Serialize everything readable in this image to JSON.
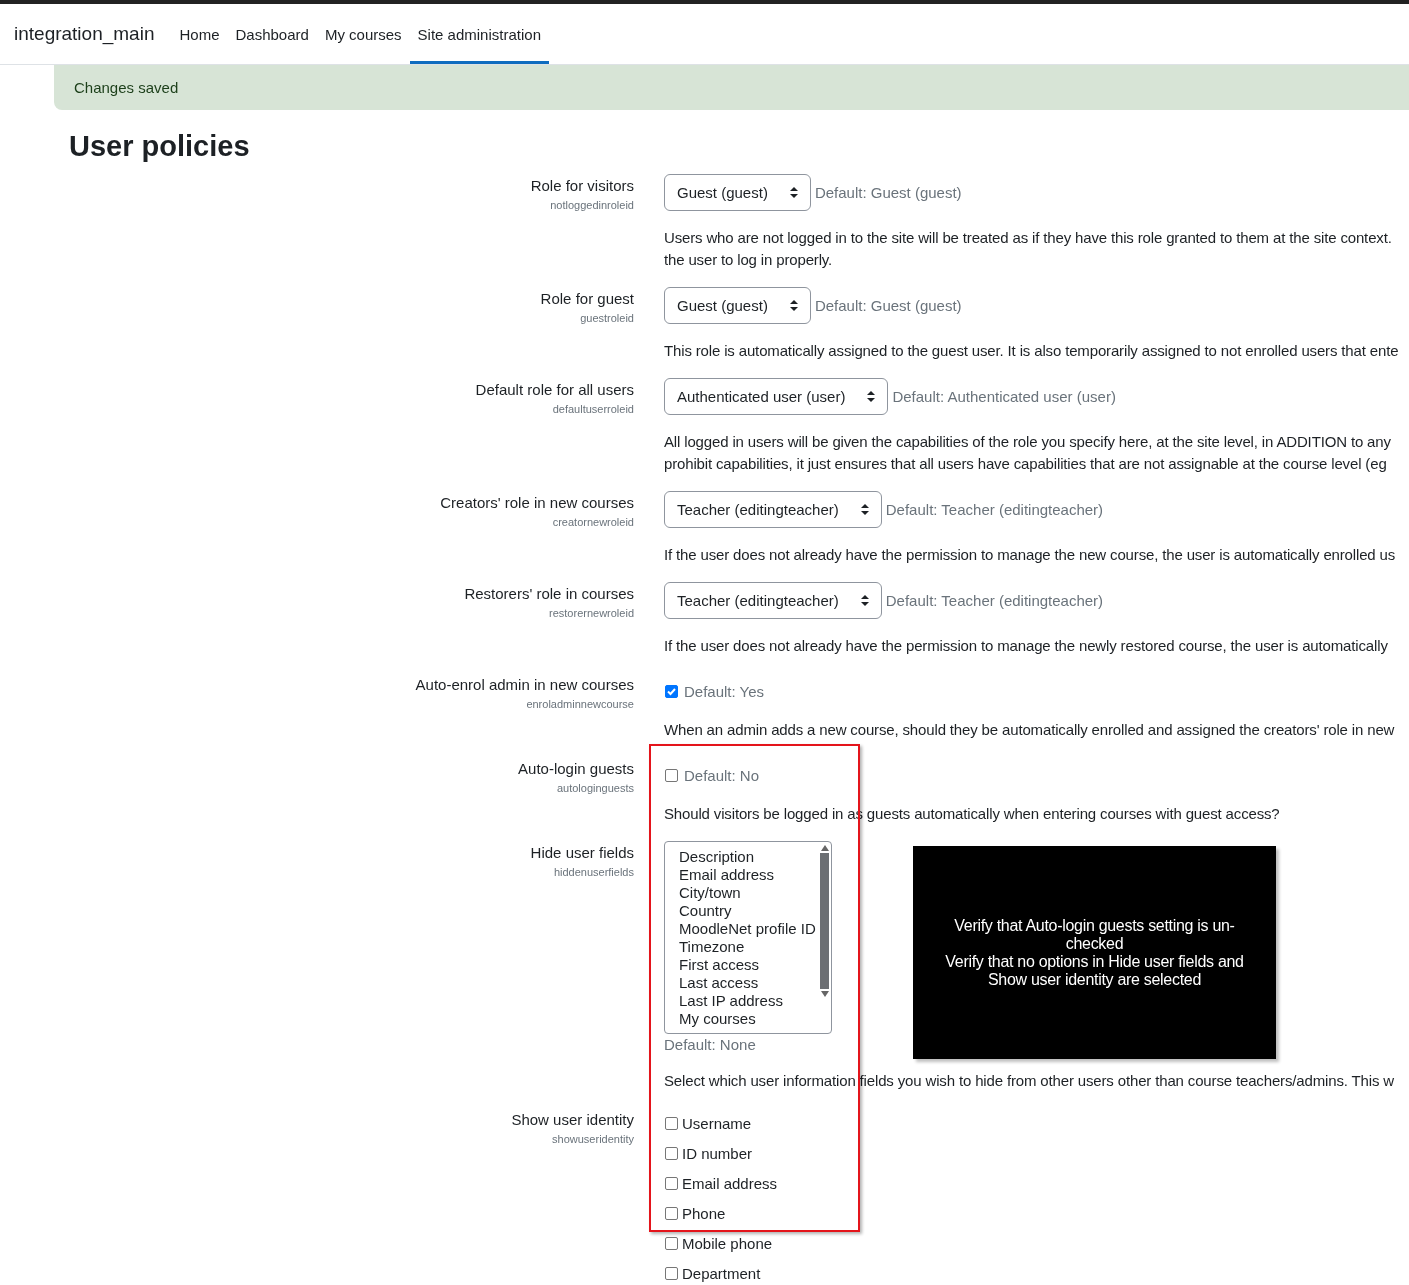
{
  "navbar": {
    "site_name": "integration_main",
    "items": [
      {
        "label": "Home",
        "selected": false
      },
      {
        "label": "Dashboard",
        "selected": false
      },
      {
        "label": "My courses",
        "selected": false
      },
      {
        "label": "Site administration",
        "selected": true
      }
    ]
  },
  "alert": {
    "text": "Changes saved"
  },
  "page_title": "User policies",
  "settings": [
    {
      "kind": "select",
      "label": "Role for visitors",
      "name": "notloggedinroleid",
      "value": "Guest (guest)",
      "default": "Default: Guest (guest)",
      "description": [
        "Users who are not logged in to the site will be treated as if they have this role granted to them at the site context.",
        "the user to log in properly."
      ]
    },
    {
      "kind": "select",
      "label": "Role for guest",
      "name": "guestroleid",
      "value": "Guest (guest)",
      "default": "Default: Guest (guest)",
      "description": [
        "This role is automatically assigned to the guest user. It is also temporarily assigned to not enrolled users that ente"
      ]
    },
    {
      "kind": "select",
      "label": "Default role for all users",
      "name": "defaultuserroleid",
      "value": "Authenticated user (user)",
      "default": "Default: Authenticated user (user)",
      "description": [
        "All logged in users will be given the capabilities of the role you specify here, at the site level, in ADDITION to any",
        "prohibit capabilities, it just ensures that all users have capabilities that are not assignable at the course level (eg"
      ]
    },
    {
      "kind": "select",
      "label": "Creators' role in new courses",
      "name": "creatornewroleid",
      "value": "Teacher (editingteacher)",
      "default": "Default: Teacher (editingteacher)",
      "description": [
        "If the user does not already have the permission to manage the new course, the user is automatically enrolled us"
      ]
    },
    {
      "kind": "select",
      "label": "Restorers' role in courses",
      "name": "restorernewroleid",
      "value": "Teacher (editingteacher)",
      "default": "Default: Teacher (editingteacher)",
      "description": [
        "If the user does not already have the permission to manage the newly restored course, the user is automatically"
      ]
    },
    {
      "kind": "checkbox",
      "label": "Auto-enrol admin in new courses",
      "name": "enroladminnewcourse",
      "checked": true,
      "default": "Default: Yes",
      "description": [
        "When an admin adds a new course, should they be automatically enrolled and assigned the creators' role in new"
      ]
    },
    {
      "kind": "checkbox",
      "label": "Auto-login guests",
      "name": "autologinguests",
      "checked": false,
      "default": "Default: No",
      "description": [
        "Should visitors be logged in as guests automatically when entering courses with guest access?"
      ]
    },
    {
      "kind": "multiselect",
      "label": "Hide user fields",
      "name": "hiddenuserfields",
      "options": [
        {
          "label": "Description",
          "selected": false
        },
        {
          "label": "Email address",
          "selected": false
        },
        {
          "label": "City/town",
          "selected": false
        },
        {
          "label": "Country",
          "selected": false
        },
        {
          "label": "MoodleNet profile ID",
          "selected": false
        },
        {
          "label": "Timezone",
          "selected": false
        },
        {
          "label": "First access",
          "selected": false
        },
        {
          "label": "Last access",
          "selected": false
        },
        {
          "label": "Last IP address",
          "selected": false
        },
        {
          "label": "My courses",
          "selected": false
        }
      ],
      "default": "Default: None",
      "description": [
        "Select which user information fields you wish to hide from other users other than course teachers/admins. This w"
      ]
    },
    {
      "kind": "checkboxes",
      "label": "Show user identity",
      "name": "showuseridentity",
      "options": [
        {
          "label": "Username",
          "checked": false
        },
        {
          "label": "ID number",
          "checked": false
        },
        {
          "label": "Email address",
          "checked": false
        },
        {
          "label": "Phone",
          "checked": false
        },
        {
          "label": "Mobile phone",
          "checked": false
        },
        {
          "label": "Department",
          "checked": false
        }
      ]
    }
  ],
  "annotation": {
    "callout_lines": [
      "Verify that Auto-login guests setting is un-",
      "checked",
      "Verify that no options in Hide user fields and",
      "Show user identity are selected"
    ]
  }
}
